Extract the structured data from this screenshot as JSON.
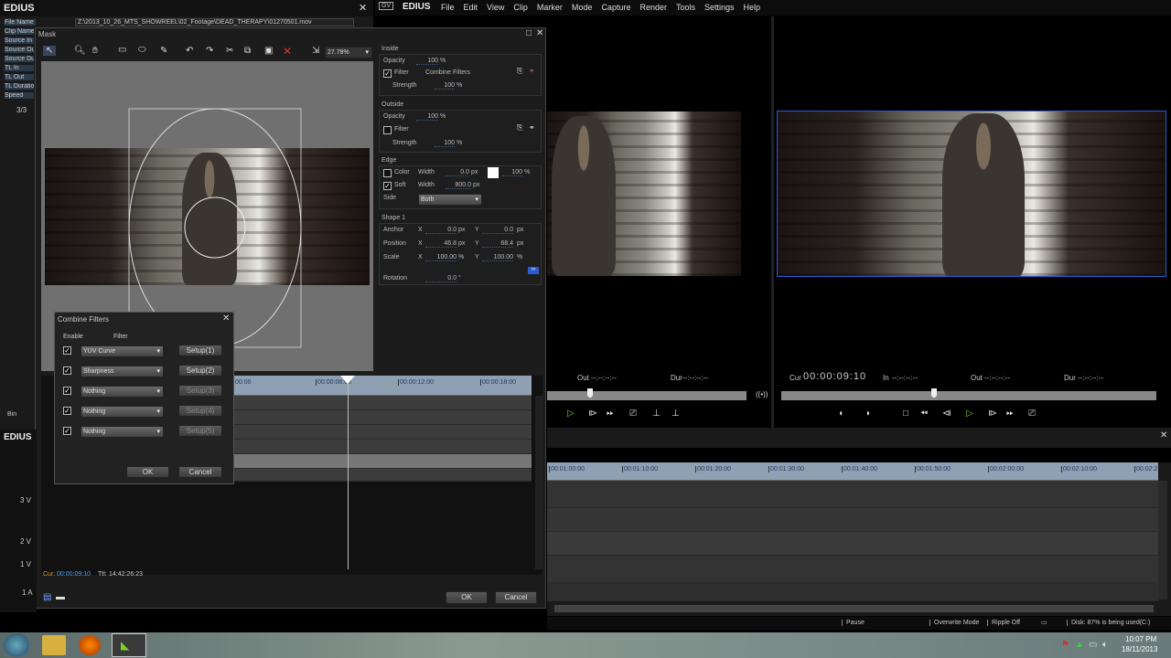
{
  "left_panel": {
    "title": "EDIUS",
    "file_name_label": "File Name",
    "file_name": "Z:\\2013_10_26_MTS_SHOWREEL\\02_Footage\\DEAD_THERAPY\\01270501.mov",
    "labels": [
      "Clip Name",
      "Source In",
      "Source Out",
      "Source Duration",
      "TL In",
      "TL Out",
      "TL Duration",
      "Speed"
    ],
    "count": "3/3",
    "bin_tab": "Bin"
  },
  "mask": {
    "title": "Mask",
    "zoom": "27.78%",
    "cur_label": "Cur:",
    "cur": "00:00:09:10",
    "ttl_label": "Ttl:",
    "ttl": "14:42:26:23",
    "ok": "OK",
    "cancel": "Cancel",
    "ruler": [
      "00:00",
      "00:00:06:00",
      "00:00:12:00",
      "00:00:18:00"
    ],
    "inside": {
      "title": "Inside",
      "opacity_label": "Opacity",
      "opacity": "100",
      "filter_label": "Filter",
      "filter_value": "Combine Filters",
      "strength_label": "Strength",
      "strength": "100"
    },
    "outside": {
      "title": "Outside",
      "opacity_label": "Opacity",
      "opacity": "100",
      "filter_label": "Filter",
      "strength_label": "Strength",
      "strength": "100"
    },
    "edge": {
      "title": "Edge",
      "color_label": "Color",
      "width_label": "Width",
      "color_width": "0.0",
      "color_pct": "100",
      "soft_label": "Soft",
      "soft_width": "800.0",
      "side_label": "Side",
      "side": "Both"
    },
    "shape": {
      "title": "Shape 1",
      "anchor_label": "Anchor",
      "anchor_x": "0.0",
      "anchor_y": "0.0",
      "position_label": "Position",
      "position_x": "46.8",
      "position_y": "68.4",
      "scale_label": "Scale",
      "scale_x": "100.00",
      "scale_y": "100.00",
      "rotation_label": "Rotation",
      "rotation": "0.0"
    },
    "units": {
      "pct": "%",
      "px": "px",
      "deg": "°",
      "x": "X",
      "y": "Y"
    }
  },
  "combine": {
    "title": "Combine Filters",
    "enable_header": "Enable",
    "filter_header": "Filter",
    "rows": [
      {
        "filter": "YUV Curve",
        "setup": "Setup(1)"
      },
      {
        "filter": "Sharpness",
        "setup": "Setup(2)"
      },
      {
        "filter": "Nothing",
        "setup": "Setup(3)"
      },
      {
        "filter": "Nothing",
        "setup": "Setup(4)"
      },
      {
        "filter": "Nothing",
        "setup": "Setup(5)"
      }
    ],
    "ok": "OK",
    "cancel": "Cancel"
  },
  "app": {
    "title": "EDIUS",
    "menu": [
      "File",
      "Edit",
      "View",
      "Clip",
      "Marker",
      "Mode",
      "Capture",
      "Render",
      "Tools",
      "Settings",
      "Help"
    ]
  },
  "player": {
    "out_label": "Out",
    "out": "--:--:--:--",
    "dur_label": "Dur",
    "dur": "--:--:--:--",
    "position": 0.2
  },
  "recorder": {
    "cur_label": "Cur",
    "cur": "00:00:09:10",
    "in_label": "In",
    "in": "--:--:--:--",
    "out_label": "Out",
    "out": "--:--:--:--",
    "dur_label": "Dur",
    "dur": "--:--:--:--",
    "position": 0.4
  },
  "timeline": {
    "second_title": "EDIUS",
    "ruler": [
      "00:01:00:00",
      "00:01:10:00",
      "00:01:20:00",
      "00:01:30:00",
      "00:01:40:00",
      "00:01:50:00",
      "00:02:00:00",
      "00:02:10:00",
      "00:02:2"
    ],
    "tracks": [
      "3 V",
      "2 V",
      "1 V",
      "1 A"
    ]
  },
  "status": {
    "pause": "Pause",
    "mode": "Overwrite Mode",
    "ripple": "Ripple Off",
    "disk": "Disk: 87% is being used(C:)"
  },
  "taskbar": {
    "time": "10:07 PM",
    "date": "18/11/2013"
  },
  "colors": {
    "accent_green": "#7fd02a",
    "selection_blue": "#2a5cd0",
    "close_red": "#e03020"
  }
}
